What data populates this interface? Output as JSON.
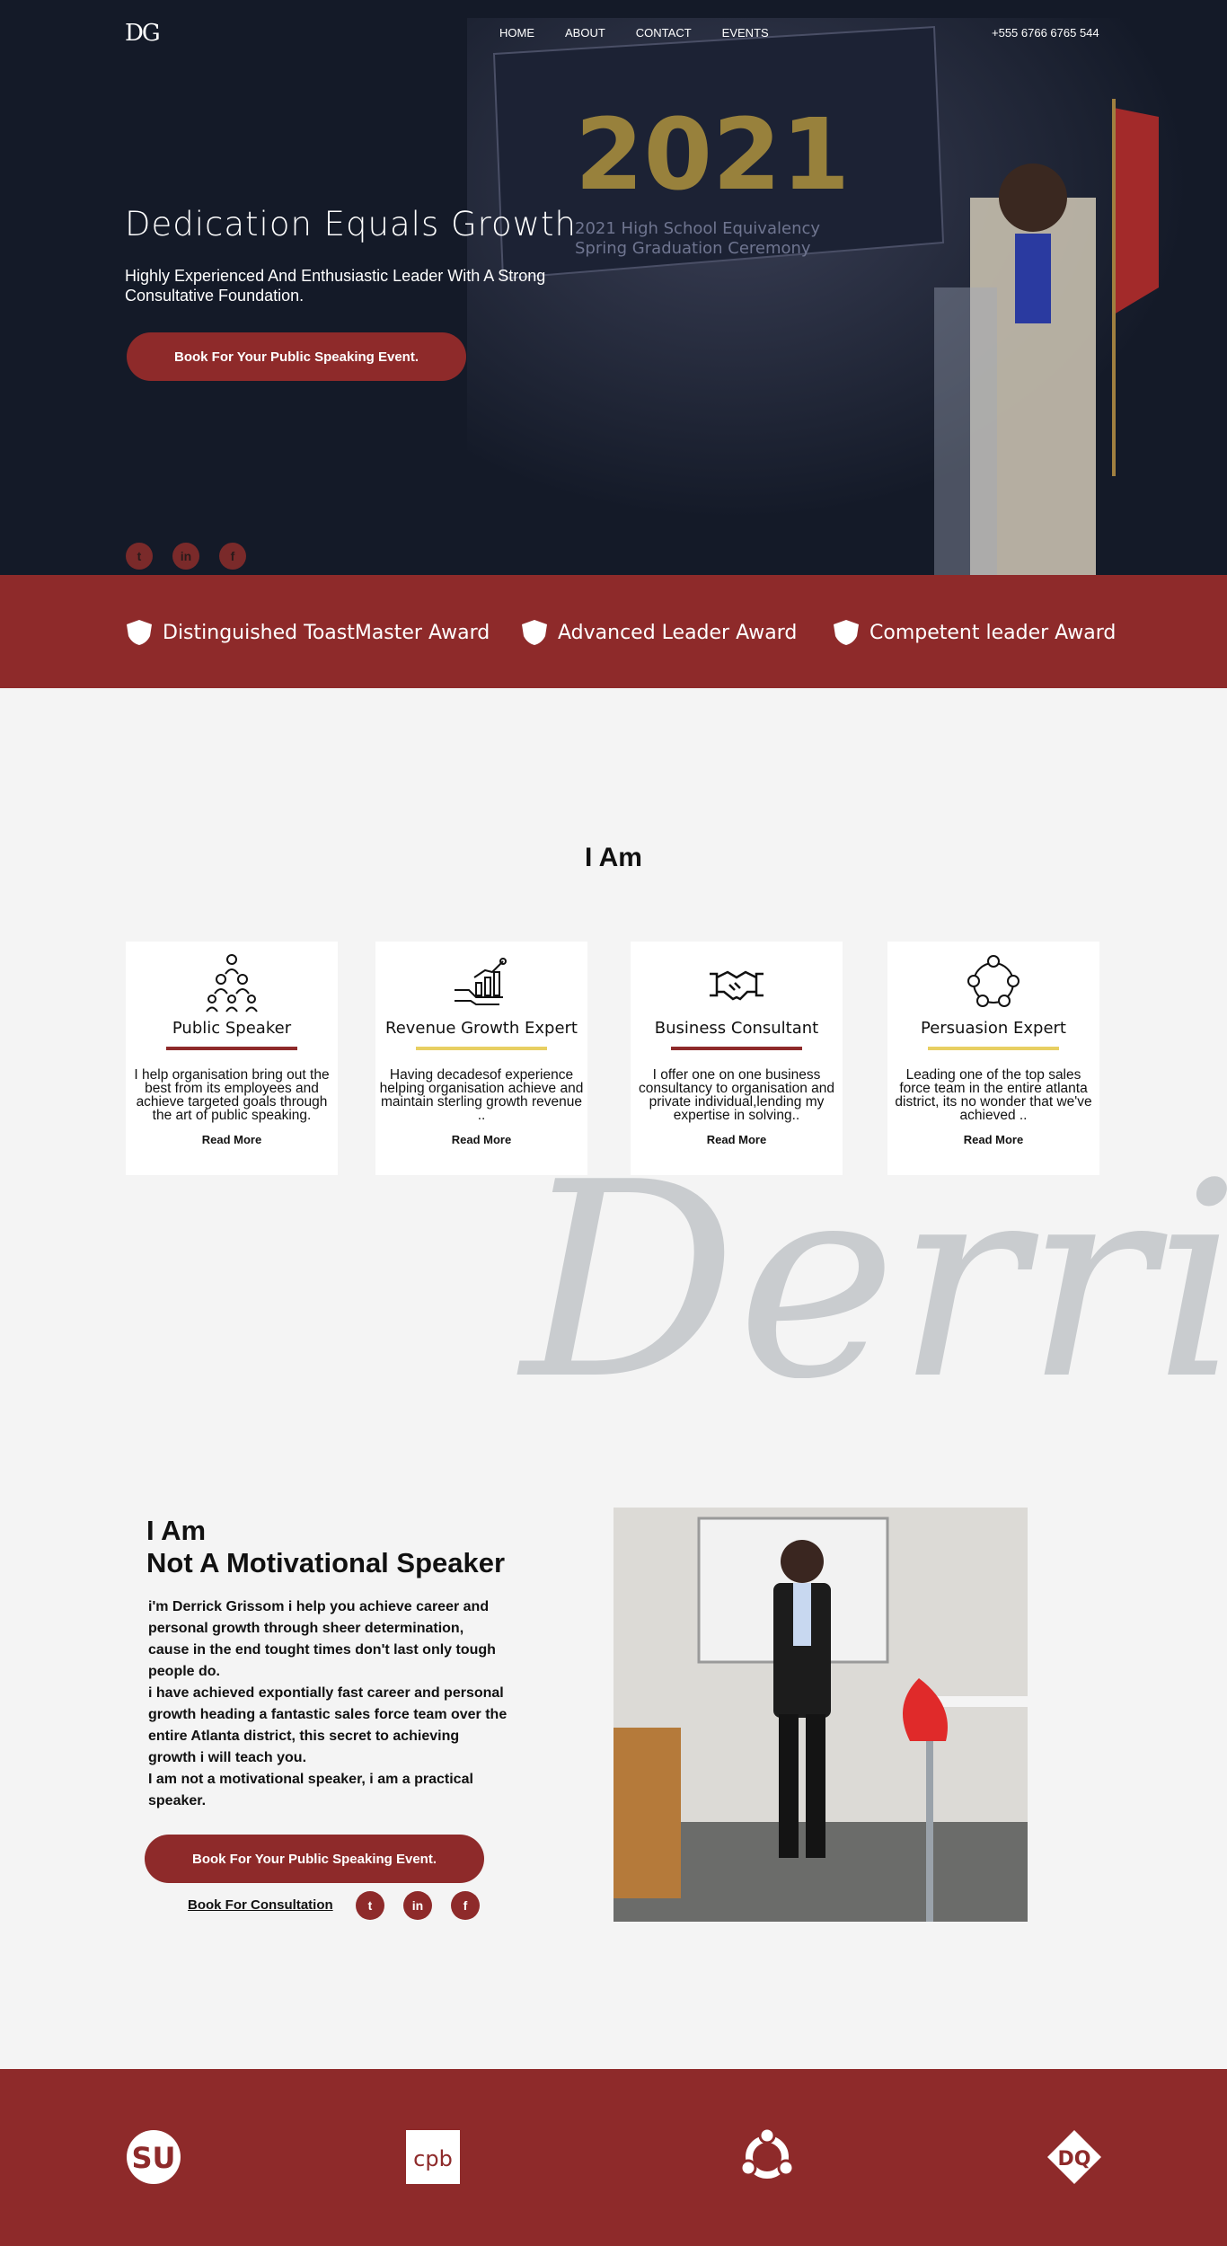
{
  "header": {
    "logo": "DG",
    "nav": [
      "HOME",
      "ABOUT",
      "CONTACT",
      "EVENTS"
    ],
    "phone": "+555 6766 6765 544"
  },
  "hero": {
    "title": "Dedication Equals Growth",
    "subtitle": "Highly Experienced And Enthusiastic Leader With A Strong Consultative Foundation.",
    "cta": "Book For Your Public Speaking Event.",
    "social": [
      "twitter-icon",
      "linkedin-icon",
      "facebook-icon"
    ]
  },
  "awards": [
    "Distinguished ToastMaster Award",
    "Advanced Leader Award",
    "Competent leader Award"
  ],
  "iam": {
    "title": "I Am",
    "cards": [
      {
        "title": "Public Speaker",
        "text": "I help organisation bring out the best from its employees and achieve targeted goals through the art of public speaking.",
        "more": "Read More",
        "bar_color": "#8e2a2a",
        "icon": "people-pyramid-icon"
      },
      {
        "title": "Revenue Growth Expert",
        "text": "Having decadesof experience helping organisation achieve and maintain sterling growth revenue ..",
        "more": "Read More",
        "bar_color": "#e8cf62",
        "icon": "growth-chart-icon"
      },
      {
        "title": "Business Consultant",
        "text": "I offer one on one business consultancy to organisation and private individual,lending my expertise in solving..",
        "more": "Read More",
        "bar_color": "#8e2a2a",
        "icon": "handshake-icon"
      },
      {
        "title": "Persuasion Expert",
        "text": "Leading one of the top sales force team in the entire atlanta district, its no wonder that we've achieved ..",
        "more": "Read More",
        "bar_color": "#e8cf62",
        "icon": "network-people-icon"
      }
    ]
  },
  "signature": "Derric",
  "about": {
    "line1": "I Am",
    "line2": "Not A Motivational Speaker",
    "para1": "i'm Derrick Grissom i help you achieve career and personal growth through sheer determination, cause in the end tought times don't last only tough people do.",
    "para2": "i have achieved expontially fast career and personal growth heading a fantastic sales force team over the entire Atlanta district, this secret to achieving growth i will teach you.",
    "para3": "I am not a motivational speaker, i am a practical speaker.",
    "cta": "Book For Your Public Speaking Event.",
    "consult": "Book For Consultation",
    "social": [
      "twitter-icon",
      "linkedin-icon",
      "facebook-icon"
    ]
  },
  "footer": {
    "logos": [
      "stumbleupon-logo-icon",
      "cpb-logo-icon",
      "ubuntu-logo-icon",
      "dq-logo-icon"
    ],
    "cpb_text": "cpb",
    "dq_text": "DQ"
  },
  "colors": {
    "accent": "#8e2a2a",
    "gold": "#e8cf62",
    "hero_bg": "#141a28",
    "signature": "#c9cccf"
  }
}
